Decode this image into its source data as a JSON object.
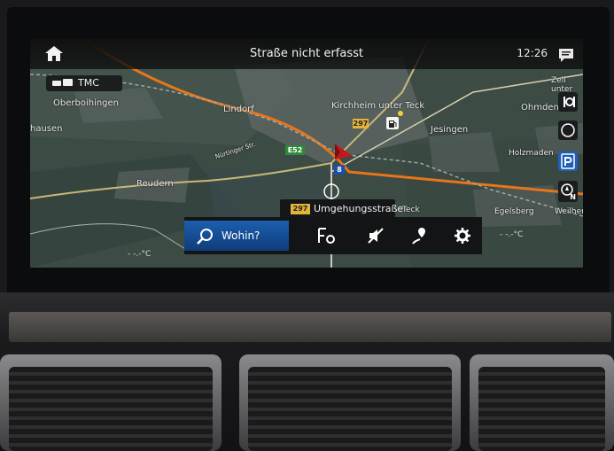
{
  "header": {
    "title": "Straße nicht erfasst",
    "time": "12:26"
  },
  "tmc": {
    "label": "TMC"
  },
  "map_labels": {
    "oberboihingen": "Oberboihingen",
    "lindorf": "Lindorf",
    "kirchheim": "Kirchheim unter Teck",
    "jesingen": "Jesingen",
    "ohmden": "Ohmden",
    "zell": "Zell unter",
    "holzmaden": "Holzmaden",
    "hausen": "hausen",
    "reudern": "Reudern",
    "egelsberg": "Egelsberg",
    "weilheim": "Weilher",
    "teck": "Teck",
    "nurtinger": "Nürtinger Str."
  },
  "road_signs": {
    "b297_top": "297",
    "e52": "E52",
    "a8": "8"
  },
  "route_banner": {
    "road_number": "297",
    "street": "Umgehungsstraße"
  },
  "menu": {
    "search_label": "Wohin?"
  },
  "temperatures": {
    "left": "- -.-°C",
    "right": "- -.-°C"
  },
  "side_buttons": {
    "north_label": "N"
  },
  "colors": {
    "accent": "#1d5fae",
    "route_orange": "#e8751a",
    "map_bg": "#3c4a44"
  }
}
